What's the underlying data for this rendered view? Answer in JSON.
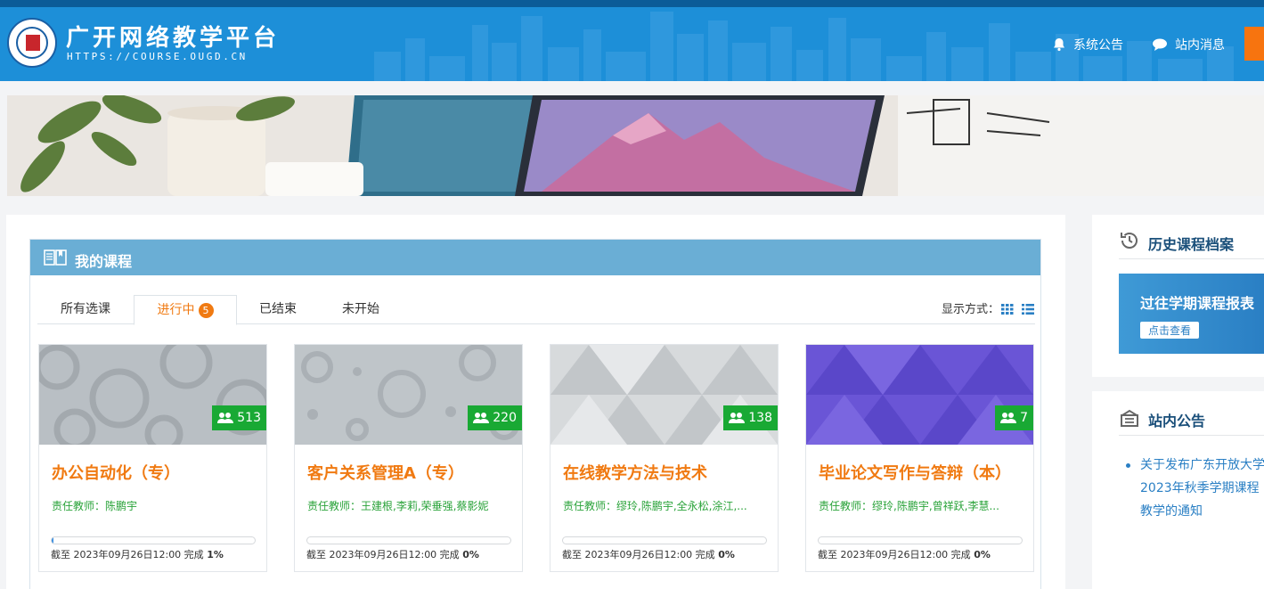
{
  "header": {
    "title": "广开网络教学平台",
    "url": "HTTPS://COURSE.OUGD.CN",
    "nav": [
      {
        "label": "系统公告",
        "icon": "bell-icon"
      },
      {
        "label": "站内消息",
        "icon": "chat-icon"
      }
    ]
  },
  "courses": {
    "heading": "我的课程",
    "tabs": [
      {
        "label": "所有选课"
      },
      {
        "label": "进行中",
        "badge": "5"
      },
      {
        "label": "已结束"
      },
      {
        "label": "未开始"
      }
    ],
    "view_label": "显示方式：",
    "cards": [
      {
        "title": "办公自动化（专）",
        "count": "513",
        "teacher": "责任教师：陈鹏宇",
        "deadline": "截至 2023年09月26日12:00 完成",
        "progress_text": "1%",
        "progress": 0.01
      },
      {
        "title": "客户关系管理A（专）",
        "count": "220",
        "teacher": "责任教师：王建根,李莉,荣垂强,蔡影妮",
        "deadline": "截至 2023年09月26日12:00 完成",
        "progress_text": "0%",
        "progress": 0
      },
      {
        "title": "在线教学方法与技术",
        "count": "138",
        "teacher": "责任教师：缪玲,陈鹏宇,全永松,涂江,...",
        "deadline": "截至 2023年09月26日12:00 完成",
        "progress_text": "0%",
        "progress": 0
      },
      {
        "title": "毕业论文写作与答辩（本）",
        "count": "7",
        "teacher": "责任教师：缪玲,陈鹏宇,曾祥跃,李慧...",
        "deadline": "截至 2023年09月26日12:00 完成",
        "progress_text": "0%",
        "progress": 0
      }
    ]
  },
  "sidebar": {
    "history_title": "历史课程档案",
    "promo_text": "过往学期课程报表",
    "promo_button": "点击查看",
    "notice_title": "站内公告",
    "notice_text": "关于发布广东开放大学2023年秋季学期课程教学的通知"
  },
  "colors": {
    "header_bg": "#1d8fd8",
    "accent_orange": "#f07a12",
    "count_green": "#19a934",
    "section_head": "#6aaed5",
    "link_blue": "#2a7fc4"
  }
}
